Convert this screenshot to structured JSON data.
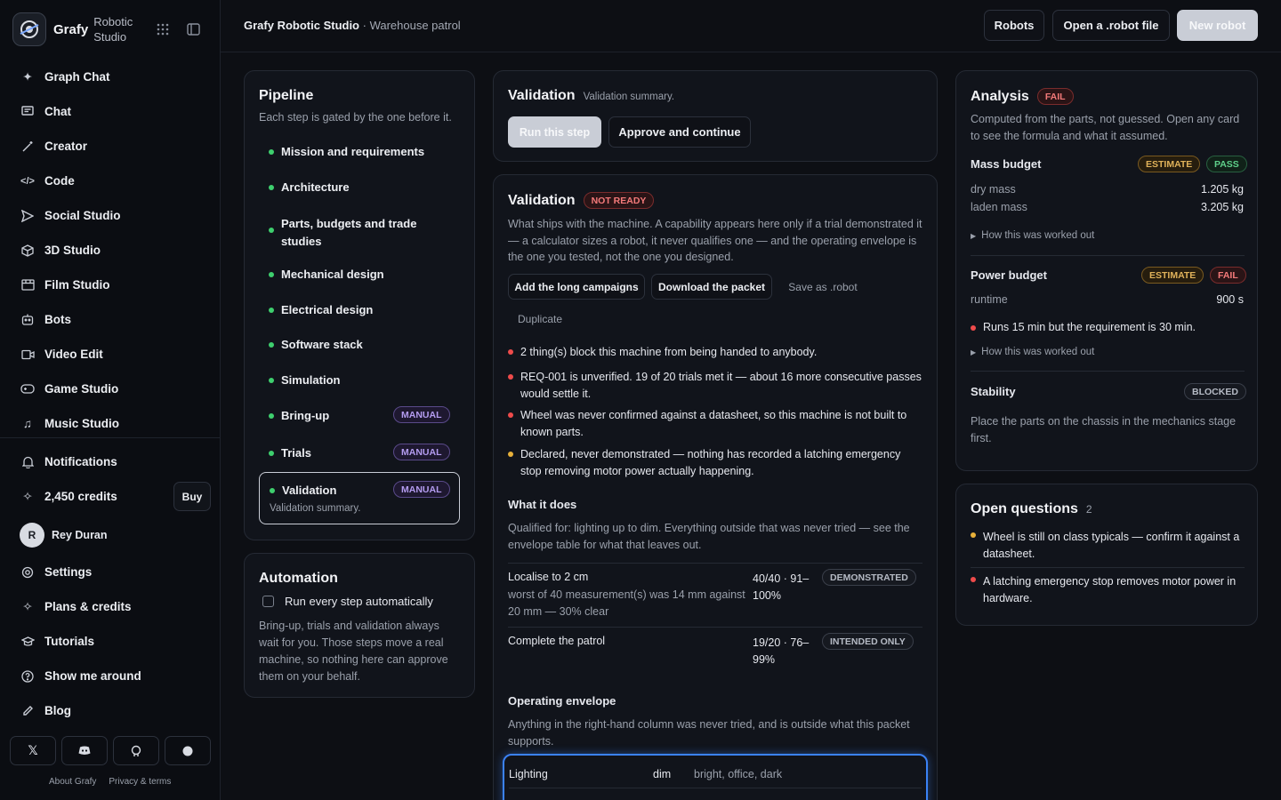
{
  "brand": {
    "name": "Grafy",
    "sub": "Robotic Studio"
  },
  "nav": [
    {
      "label": "Graph Chat",
      "icon": "sparkle-icon"
    },
    {
      "label": "Chat",
      "icon": "message-icon"
    },
    {
      "label": "Creator",
      "icon": "wand-icon"
    },
    {
      "label": "Code",
      "icon": "code-icon"
    },
    {
      "label": "Social Studio",
      "icon": "send-icon"
    },
    {
      "label": "3D Studio",
      "icon": "cube-icon"
    },
    {
      "label": "Film Studio",
      "icon": "film-icon"
    },
    {
      "label": "Bots",
      "icon": "bot-icon"
    },
    {
      "label": "Video Edit",
      "icon": "video-icon"
    },
    {
      "label": "Game Studio",
      "icon": "gamepad-icon"
    },
    {
      "label": "Music Studio",
      "icon": "music-icon"
    }
  ],
  "nav2": {
    "notifications": "Notifications",
    "credits": "2,450 credits",
    "buy": "Buy",
    "user_initial": "R",
    "user_name": "Rey Duran",
    "settings": "Settings",
    "plans": "Plans & credits",
    "tutorials": "Tutorials",
    "tour": "Show me around",
    "blog": "Blog"
  },
  "footer": {
    "about": "About Grafy",
    "privacy": "Privacy & terms"
  },
  "topbar": {
    "crumb_app": "Grafy Robotic Studio",
    "crumb_sep": " · ",
    "crumb_page": "Warehouse patrol",
    "robots": "Robots",
    "open_file": "Open a .robot file",
    "new_robot": "New robot"
  },
  "pipeline": {
    "title": "Pipeline",
    "subtitle": "Each step is gated by the one before it.",
    "steps": [
      "Mission and requirements",
      "Architecture",
      "Parts, budgets and trade studies",
      "Mechanical design",
      "Electrical design",
      "Software stack",
      "Simulation",
      "Bring-up",
      "Trials",
      "Validation"
    ],
    "manual": "MANUAL",
    "active_sub": "Validation summary."
  },
  "automation": {
    "title": "Automation",
    "checkbox_label": "Run every step automatically",
    "body": "Bring-up, trials and validation always wait for you. Those steps move a real machine, so nothing here can approve them on your behalf."
  },
  "validation_top": {
    "title": "Validation",
    "sub": "Validation summary.",
    "run": "Run this step",
    "approve": "Approve and continue"
  },
  "validation": {
    "title": "Validation",
    "status": "NOT READY",
    "desc": "What ships with the machine. A capability appears here only if a trial demonstrated it — a calculator sizes a robot, it never qualifies one — and the operating envelope is the one you tested, not the one you designed.",
    "actions": {
      "campaigns": "Add the long campaigns",
      "download": "Download the packet",
      "save": "Save as .robot",
      "duplicate": "Duplicate"
    },
    "blockers": [
      {
        "text": "2 thing(s) block this machine from being handed to anybody.",
        "level": "red"
      },
      {
        "text": "REQ-001 is unverified. 19 of 20 trials met it — about 16 more consecutive passes would settle it.",
        "level": "red"
      },
      {
        "text": "Wheel was never confirmed against a datasheet, so this machine is not built to known parts.",
        "level": "red"
      },
      {
        "text": "Declared, never demonstrated — nothing has recorded a latching emergency stop removing motor power actually happening.",
        "level": "amber"
      }
    ],
    "what_title": "What it does",
    "what_desc": "Qualified for: lighting up to dim. Everything outside that was never tried — see the envelope table for what that leaves out.",
    "capabilities": [
      {
        "name": "Localise to 2 cm",
        "detail": "worst of 40 measurement(s) was 14 mm against 20 mm — 30% clear",
        "score": "40/40 · 91–100%",
        "status": "DEMONSTRATED"
      },
      {
        "name": "Complete the patrol",
        "detail": "",
        "score": "19/20 · 76–99%",
        "status": "INTENDED ONLY"
      }
    ],
    "env_title": "Operating envelope",
    "env_desc": "Anything in the right-hand column was never tried, and is outside what this packet supports.",
    "env_rows": [
      {
        "name": "Lighting",
        "tested": "dim",
        "untested": "bright, office, dark"
      }
    ]
  },
  "analysis": {
    "title": "Analysis",
    "status": "FAIL",
    "desc": "Computed from the parts, not guessed. Open any card to see the formula and what it assumed.",
    "how": "How this was worked out",
    "mass": {
      "title": "Mass budget",
      "badge1": "ESTIMATE",
      "badge2": "PASS",
      "rows": [
        {
          "label": "dry mass",
          "value": "1.205 kg"
        },
        {
          "label": "laden mass",
          "value": "3.205 kg"
        }
      ]
    },
    "power": {
      "title": "Power budget",
      "badge1": "ESTIMATE",
      "badge2": "FAIL",
      "runtime_label": "runtime",
      "runtime_value": "900 s",
      "note": "Runs 15 min but the requirement is 30 min."
    },
    "stability": {
      "title": "Stability",
      "badge": "BLOCKED",
      "note": "Place the parts on the chassis in the mechanics stage first."
    }
  },
  "questions": {
    "title": "Open questions",
    "count": "2",
    "items": [
      {
        "text": "Wheel is still on class typicals — confirm it against a datasheet.",
        "level": "amber"
      },
      {
        "text": "A latching emergency stop removes motor power in hardware.",
        "level": "red"
      }
    ]
  },
  "colors": {
    "accent_ok": "#3ecf6e",
    "danger": "#ef4b4b",
    "warn": "#e8b13a",
    "focus": "#3b82f6"
  }
}
